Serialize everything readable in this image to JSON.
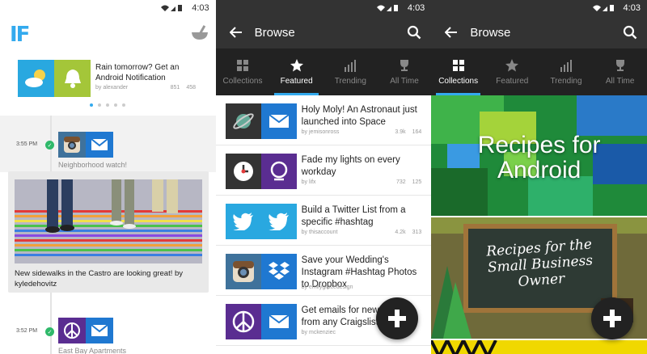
{
  "status_time": "4:03",
  "home": {
    "logo": "IF",
    "promo": {
      "title": "Rain tomorrow? Get an Android Notification",
      "author": "by alexander",
      "users": "851",
      "favorites": "458"
    },
    "feed": [
      {
        "time": "3:55 PM",
        "label": "Neighborhood watch!"
      },
      {
        "time": "3:52 PM",
        "label": "East Bay Apartments"
      }
    ],
    "card_text": "New sidewalks in the Castro are looking great! by kyledehovitz"
  },
  "browse": {
    "title": "Browse",
    "tabs": [
      "Collections",
      "Featured",
      "Trending",
      "All Time"
    ],
    "recipes": [
      {
        "title": "Holy Moly! An Astronaut just launched into Space",
        "author": "by jemisonross",
        "users": "3.9k",
        "favorites": "164"
      },
      {
        "title": "Fade my lights on every workday",
        "author": "by lifx",
        "users": "732",
        "favorites": "125"
      },
      {
        "title": "Build a Twitter List from a specific #hashtag",
        "author": "by thisaccount",
        "users": "4.2k",
        "favorites": "313"
      },
      {
        "title": "Save your Wedding's Instagram #Hashtag Photos to Dropbox",
        "author": "by emilygracedesign",
        "users": "",
        "favorites": ""
      },
      {
        "title": "Get emails for new posts from any Craigslist search",
        "author": "by mckenziec",
        "users": "",
        "favorites": ""
      }
    ]
  },
  "collections": {
    "title": "Browse",
    "cards": [
      {
        "title": "Recipes for Android"
      },
      {
        "title": "Recipes for the Small Business Owner"
      }
    ]
  },
  "colors": {
    "accent": "#33aaee",
    "appbar": "#333333",
    "tabbar": "#222222",
    "check": "#2fb96a"
  }
}
